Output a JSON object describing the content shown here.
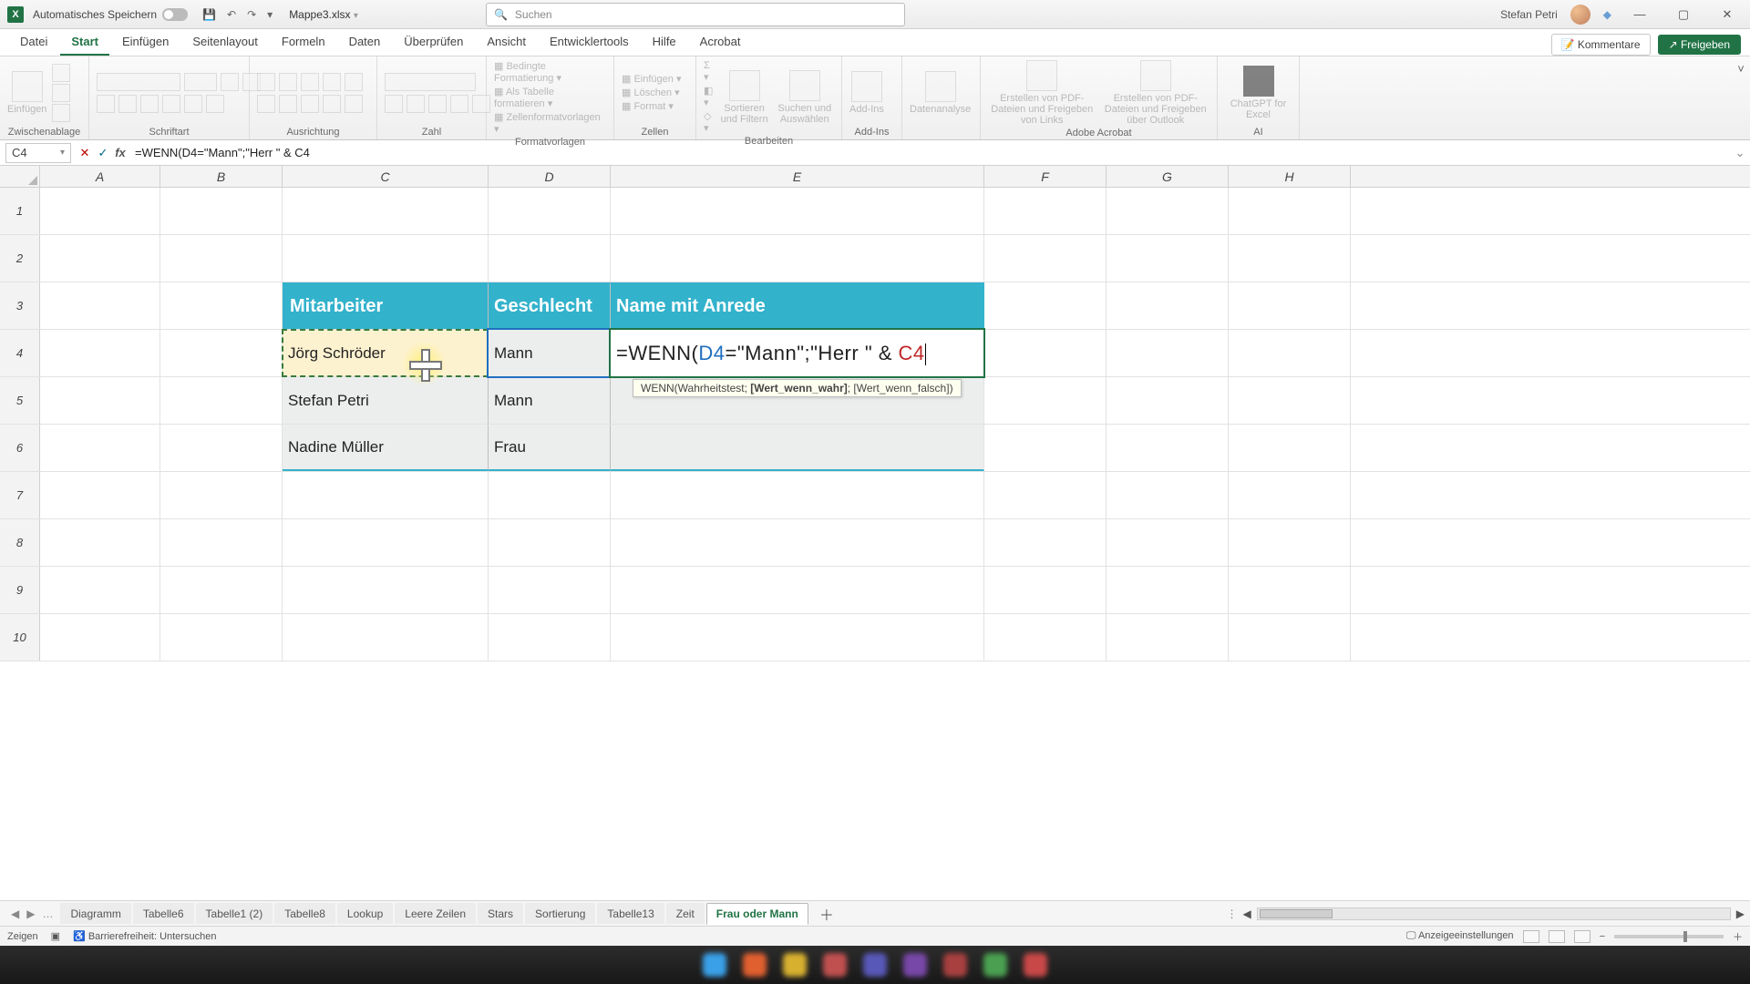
{
  "titlebar": {
    "autosave": "Automatisches Speichern",
    "docname": "Mappe3.xlsx",
    "search_placeholder": "Suchen",
    "username": "Stefan Petri"
  },
  "menu": {
    "tabs": [
      "Datei",
      "Start",
      "Einfügen",
      "Seitenlayout",
      "Formeln",
      "Daten",
      "Überprüfen",
      "Ansicht",
      "Entwicklertools",
      "Hilfe",
      "Acrobat"
    ],
    "active": "Start",
    "kommentare": "Kommentare",
    "freigeben": "Freigeben"
  },
  "ribbon": {
    "groups": {
      "zwischenablage": {
        "label": "Zwischenablage",
        "paste": "Einfügen"
      },
      "schriftart": {
        "label": "Schriftart"
      },
      "ausrichtung": {
        "label": "Ausrichtung"
      },
      "zahl": {
        "label": "Zahl"
      },
      "formatvorlagen": {
        "label": "Formatvorlagen",
        "items": [
          "Bedingte Formatierung",
          "Als Tabelle formatieren",
          "Zellenformatvorlagen"
        ]
      },
      "zellen": {
        "label": "Zellen",
        "items": [
          "Einfügen",
          "Löschen",
          "Format"
        ]
      },
      "bearbeiten": {
        "label": "Bearbeiten",
        "sort": "Sortieren und Filtern",
        "find": "Suchen und Auswählen"
      },
      "addins": {
        "label": "Add-Ins",
        "btn": "Add-Ins"
      },
      "datenanalyse": {
        "label": "",
        "btn": "Datenanalyse"
      },
      "acrobat": {
        "label": "Adobe Acrobat",
        "a": "Erstellen von PDF-Dateien und Freigeben von Links",
        "b": "Erstellen von PDF-Dateien und Freigeben über Outlook"
      },
      "ai": {
        "label": "AI",
        "btn": "ChatGPT for Excel"
      }
    }
  },
  "namebox": "C4",
  "formula": "=WENN(D4=\"Mann\";\"Herr \" & C4",
  "columns": [
    "A",
    "B",
    "C",
    "D",
    "E",
    "F",
    "G",
    "H"
  ],
  "rows": [
    "1",
    "2",
    "3",
    "4",
    "5",
    "6",
    "7",
    "8",
    "9",
    "10"
  ],
  "table": {
    "headers": {
      "c": "Mitarbeiter",
      "d": "Geschlecht",
      "e": "Name mit Anrede"
    },
    "rows": [
      {
        "c": "Jörg Schröder",
        "d": "Mann"
      },
      {
        "c": "Stefan Petri",
        "d": "Mann"
      },
      {
        "c": "Nadine Müller",
        "d": "Frau"
      }
    ]
  },
  "edit": {
    "prefix": "=WENN(",
    "ref1": "D4",
    "mid": "=\"Mann\";\"Herr \" & ",
    "ref2": "C4"
  },
  "tooltip": {
    "fn": "WENN(",
    "a": "Wahrheitstest; ",
    "b": "[Wert_wenn_wahr]",
    "c": "; [Wert_wenn_falsch])"
  },
  "sheets": [
    "Diagramm",
    "Tabelle6",
    "Tabelle1 (2)",
    "Tabelle8",
    "Lookup",
    "Leere Zeilen",
    "Stars",
    "Sortierung",
    "Tabelle13",
    "Zeit",
    "Frau oder Mann"
  ],
  "active_sheet": "Frau oder Mann",
  "status": {
    "mode": "Zeigen",
    "acc": "Barrierefreiheit: Untersuchen",
    "display": "Anzeigeeinstellungen"
  },
  "taskbar_colors": [
    "#3aa0e8",
    "#e06030",
    "#d8b030",
    "#c05050",
    "#5858b8",
    "#7848a8",
    "#a84040",
    "#4aa050",
    "#c84848"
  ]
}
